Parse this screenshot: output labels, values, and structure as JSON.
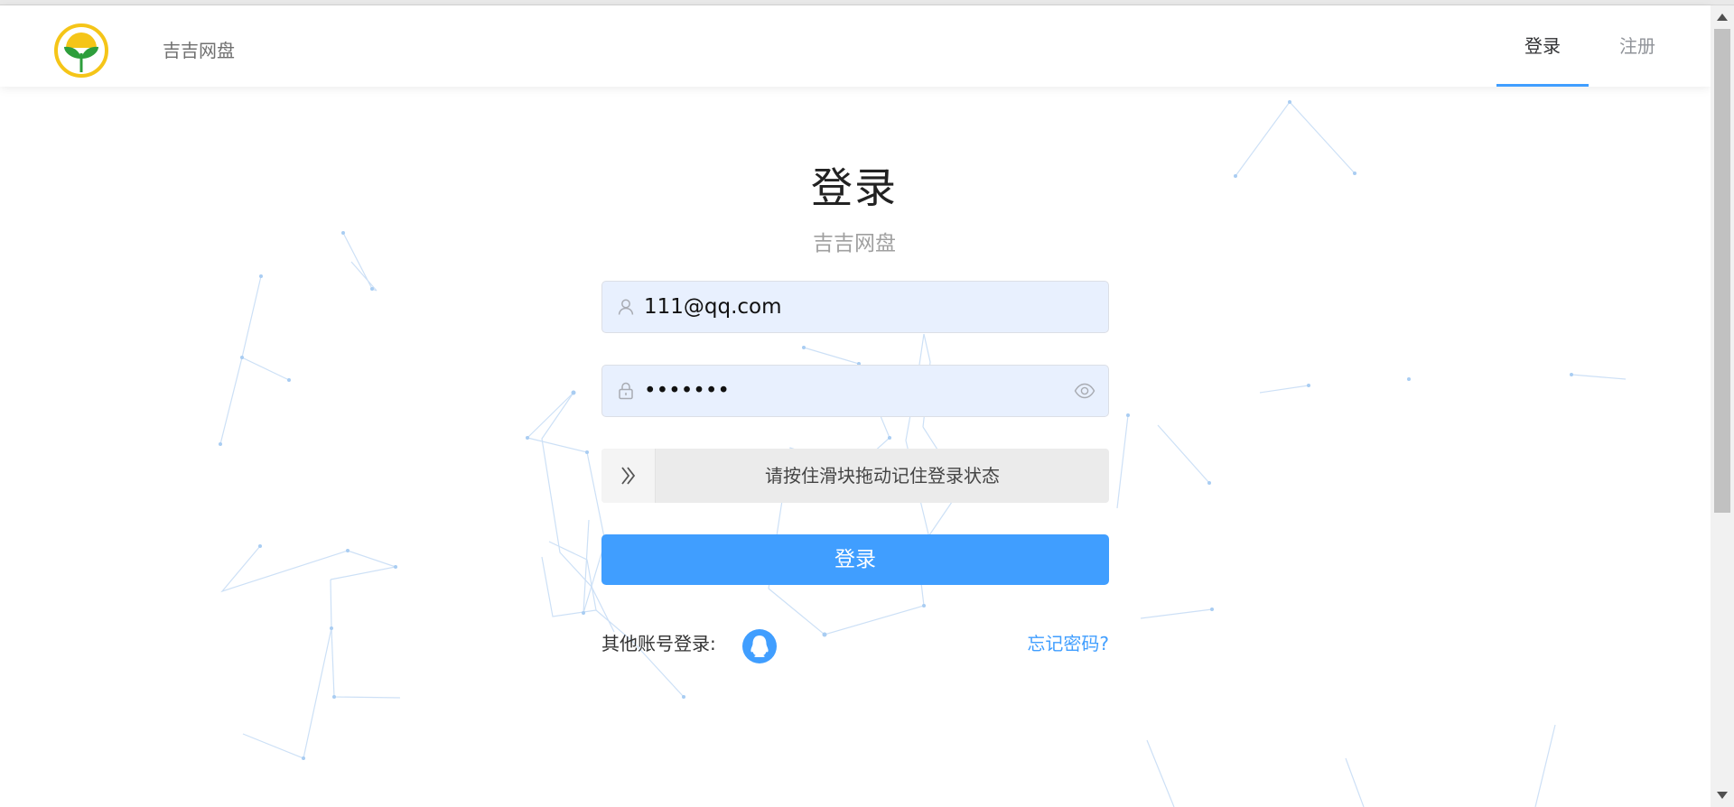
{
  "header": {
    "app_name": "吉吉网盘",
    "tabs": [
      {
        "label": "登录",
        "active": true
      },
      {
        "label": "注册",
        "active": false
      }
    ]
  },
  "form": {
    "title": "登录",
    "subtitle": "吉吉网盘",
    "email": {
      "value": "111@qq.com",
      "icon": "user-icon"
    },
    "password": {
      "value": "•••••••",
      "icon": "lock-icon",
      "toggle_icon": "eye-icon"
    },
    "slider": {
      "text": "请按住滑块拖动记住登录状态",
      "handle_icon": "double-chevron-right-icon"
    },
    "submit_label": "登录",
    "other_login_label": "其他账号登录:",
    "other_login_providers": [
      {
        "icon": "qq-icon"
      }
    ],
    "forgot_password_label": "忘记密码?"
  },
  "colors": {
    "accent": "#409eff",
    "input_bg": "#e8f0fe",
    "slider_bg": "#ebebeb",
    "logo_ring": "#f5c518",
    "logo_leaf": "#2e9e3c"
  }
}
